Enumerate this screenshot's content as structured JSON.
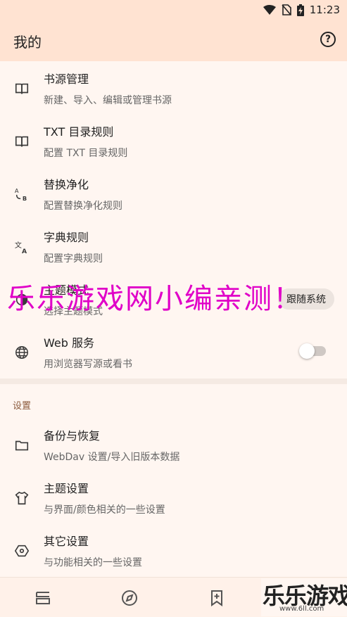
{
  "status": {
    "time": "11:23"
  },
  "appbar": {
    "title": "我的",
    "help_icon": "help-circle-icon"
  },
  "items": [
    {
      "title": "书源管理",
      "subtitle": "新建、导入、编辑或管理书源",
      "icon": "book-open-icon"
    },
    {
      "title": "TXT 目录规则",
      "subtitle": "配置 TXT 目录规则",
      "icon": "book-open-icon"
    },
    {
      "title": "替换净化",
      "subtitle": "配置替换净化规则",
      "icon": "replace-ab-icon"
    },
    {
      "title": "字典规则",
      "subtitle": "配置字典规则",
      "icon": "translate-icon"
    },
    {
      "title": "主题模式",
      "subtitle": "选择主题模式",
      "icon": "theme-icon",
      "value": "跟随系统"
    },
    {
      "title": "Web 服务",
      "subtitle": "用浏览器写源或看书",
      "icon": "globe-icon",
      "toggle_on": false
    }
  ],
  "settings": {
    "header": "设置",
    "items": [
      {
        "title": "备份与恢复",
        "subtitle": "WebDav 设置/导入旧版本数据",
        "icon": "folder-icon"
      },
      {
        "title": "主题设置",
        "subtitle": "与界面/颜色相关的一些设置",
        "icon": "tshirt-icon"
      },
      {
        "title": "其它设置",
        "subtitle": "与功能相关的一些设置",
        "icon": "hexagon-icon"
      }
    ]
  },
  "bottom_nav": [
    "bookshelf-icon",
    "compass-icon",
    "bookmark-add-icon",
    "person-icon"
  ],
  "watermark": "乐乐游戏网小编亲测！",
  "logo": {
    "text": "乐乐游戏",
    "url": "www.6ll.com"
  },
  "colors": {
    "appbar": "#FFE3D2",
    "background": "#FFF6F1",
    "section": "#8B5A3C",
    "watermark": "#E000C8"
  }
}
